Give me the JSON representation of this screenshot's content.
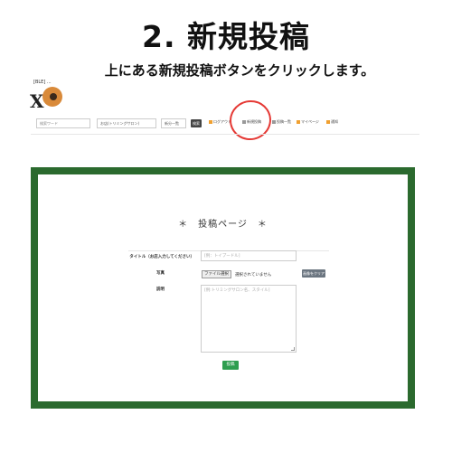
{
  "heading": {
    "title": "2. 新規投稿",
    "description": "上にある新規投稿ボタンをクリックします。"
  },
  "site_header": {
    "logo_text": "[BLE] ...",
    "search_placeholder": "検索ワード",
    "salon_select": "お店(トリミングサロン)",
    "sort_select": "新分一覧",
    "search_button": "検索",
    "nav_links": [
      {
        "label": "ログアウト",
        "icon": "logout-icon"
      },
      {
        "label": "新規投稿",
        "icon": "new-post-icon"
      },
      {
        "label": "投稿一覧",
        "icon": "list-icon"
      },
      {
        "label": "マイページ",
        "icon": "user-icon"
      },
      {
        "label": "通知",
        "icon": "bell-icon"
      }
    ],
    "highlight_color": "#e53935"
  },
  "post_page": {
    "title": "＊　投稿ページ　＊",
    "fields": {
      "title_label": "タイトル（お店入力してください）",
      "title_placeholder": "[例：トイプードル]",
      "photo_label": "写真",
      "file_button": "ファイル選択",
      "file_status": "選択されていません",
      "clear_button": "画像をクリア",
      "description_label": "説明",
      "description_placeholder": "[例:トリミングサロン名、スタイル]"
    },
    "submit_button": "投稿",
    "frame_color": "#2b6a2e"
  }
}
